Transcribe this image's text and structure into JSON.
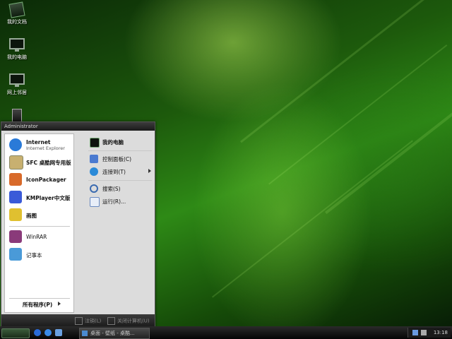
{
  "desktop": {
    "icons": [
      {
        "label": "我的文档",
        "icon": "my-documents-icon"
      },
      {
        "label": "我的电脑",
        "icon": "my-computer-icon"
      },
      {
        "label": "网上邻居",
        "icon": "network-places-icon"
      },
      {
        "label": "",
        "icon": "recycle-bin-icon"
      }
    ]
  },
  "start_menu": {
    "user": "Administrator",
    "left_items": [
      {
        "title": "Internet",
        "subtitle": "Internet Explorer",
        "icon": "internet-explorer-icon",
        "color": "#2a7ad8"
      },
      {
        "title": "SFC 桌酷网专用版",
        "icon": "sfc-app-icon",
        "color": "#c8b070"
      },
      {
        "title": "IconPackager",
        "icon": "iconpackager-icon",
        "color": "#d86a2a"
      },
      {
        "title": "KMPlayer中文版",
        "icon": "kmplayer-icon",
        "color": "#3a5ad8"
      },
      {
        "title": "画图",
        "icon": "paint-icon",
        "color": "#e0c030"
      },
      {
        "title": "WinRAR",
        "icon": "winrar-icon",
        "color": "#8a3a7a"
      },
      {
        "title": "记事本",
        "icon": "notepad-icon",
        "color": "#4a9ad8"
      }
    ],
    "all_programs": "所有程序(P)",
    "right_items": [
      {
        "label": "我的电脑",
        "icon": "my-computer-icon",
        "bold": true
      },
      {
        "label": "控制面板(C)",
        "icon": "control-panel-icon"
      },
      {
        "label": "连接到(T)",
        "icon": "connect-to-icon",
        "submenu": true
      },
      {
        "label": "搜索(S)",
        "icon": "search-icon"
      },
      {
        "label": "运行(R)...",
        "icon": "run-icon"
      }
    ],
    "footer": {
      "logoff": "注销(L)",
      "shutdown": "关闭计算机(U)"
    }
  },
  "taskbar": {
    "window_title": "桌面 - 壁纸 - 桌酷...",
    "clock": "13:18"
  }
}
